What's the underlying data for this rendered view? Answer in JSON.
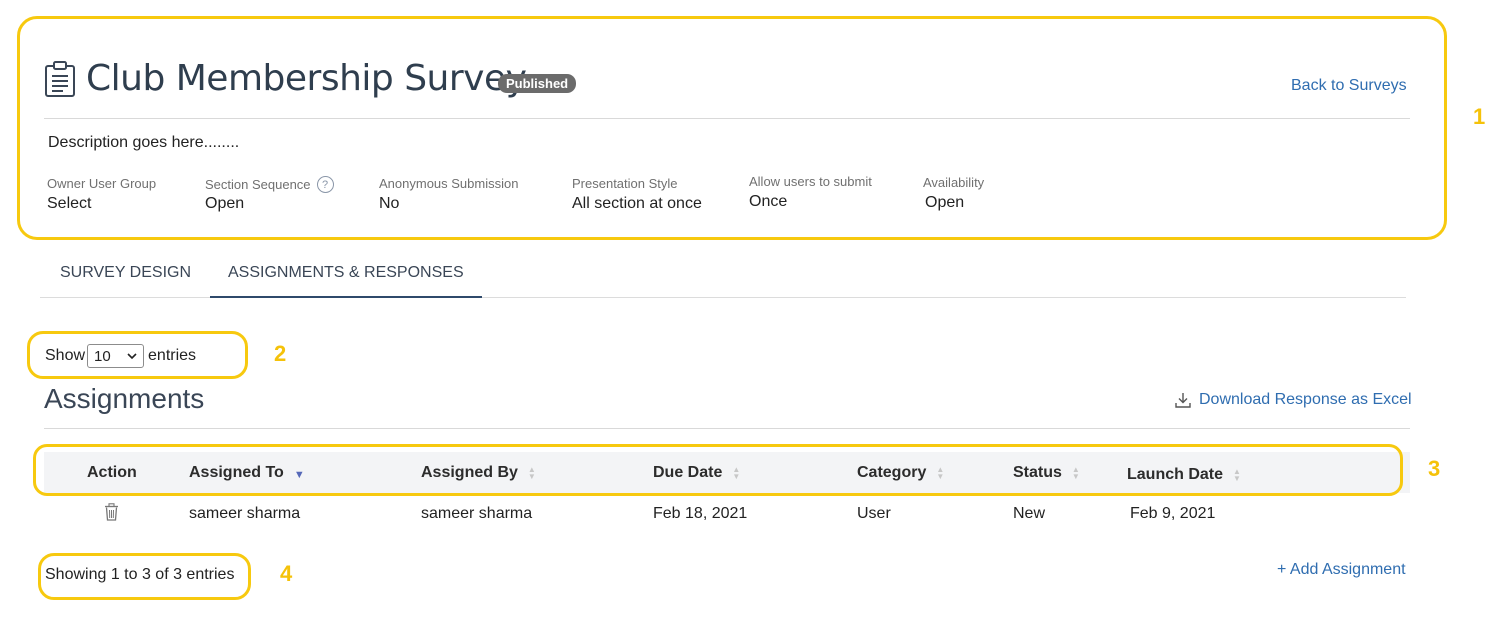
{
  "header": {
    "title": "Club Membership Survey",
    "status_badge": "Published",
    "back_link": "Back to Surveys",
    "description": "Description goes here........"
  },
  "meta": [
    {
      "label": "Owner User Group",
      "value": "Select"
    },
    {
      "label": "Section Sequence",
      "value": "Open",
      "help_icon": "?"
    },
    {
      "label": "Anonymous Submission",
      "value": "No"
    },
    {
      "label": "Presentation Style",
      "value": "All section at once"
    },
    {
      "label": "Allow users to submit",
      "value": "Once"
    },
    {
      "label": "Availability",
      "value": "Open"
    }
  ],
  "tabs": [
    {
      "label": "SURVEY DESIGN",
      "active": false
    },
    {
      "label": "ASSIGNMENTS & RESPONSES",
      "active": true
    }
  ],
  "entries": {
    "show_label": "Show",
    "selected": "10",
    "entries_label": "entries"
  },
  "assignments": {
    "title": "Assignments",
    "download_label": "Download Response as Excel",
    "columns": [
      "Action",
      "Assigned To",
      "Assigned By",
      "Due Date",
      "Category",
      "Status",
      "Launch Date"
    ],
    "rows": [
      {
        "assigned_to": "sameer sharma",
        "assigned_by": "sameer sharma",
        "due_date": "Feb 18, 2021",
        "category": "User",
        "status": "New",
        "launch_date": "Feb 9, 2021"
      }
    ],
    "showing_text": "Showing 1 to 3 of 3 entries",
    "add_label": "+ Add Assignment"
  },
  "annotations": [
    "1",
    "2",
    "3",
    "4"
  ],
  "colors": {
    "highlight": "#f7c90f",
    "link": "#2f6db0",
    "badge": "#6b6b6b",
    "sort_active": "#5568b8"
  },
  "icons": [
    "clipboard-icon",
    "help-icon",
    "download-icon",
    "trash-icon",
    "sort-icon",
    "chevron-down-icon"
  ]
}
